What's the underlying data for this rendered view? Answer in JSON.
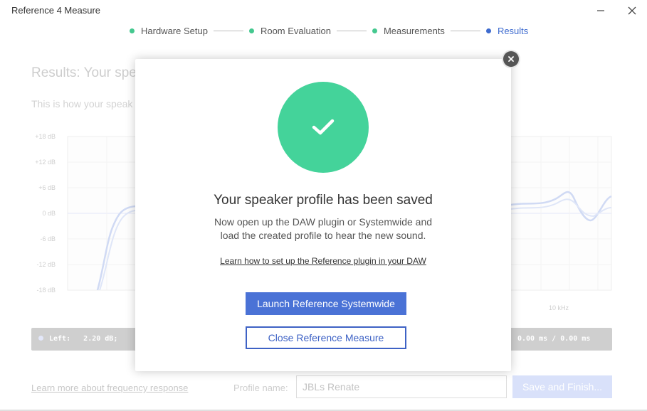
{
  "window": {
    "title": "Reference 4 Measure"
  },
  "stepper": {
    "steps": [
      {
        "label": "Hardware Setup"
      },
      {
        "label": "Room Evaluation"
      },
      {
        "label": "Measurements"
      },
      {
        "label": "Results"
      }
    ]
  },
  "background": {
    "title": "Results: Your spe",
    "subtitle": "This is how your speak",
    "chart": {
      "y_ticks": [
        "+18 dB",
        "+12 dB",
        "+6 dB",
        "0 dB",
        "-6 dB",
        "-12 dB",
        "-18 dB"
      ],
      "x_tick": "10 kHz"
    },
    "stats": {
      "left_label": "Left:",
      "left_value": "2.20 dB;",
      "right_value": "0.00 ms / 0.00 ms"
    },
    "learn_link": "Learn more about frequency response",
    "profile_label": "Profile name:",
    "profile_value": "JBLs Renate",
    "save_label": "Save and Finish..."
  },
  "modal": {
    "heading": "Your speaker profile has been saved",
    "text_line1": "Now open up the DAW plugin or Systemwide and",
    "text_line2": "load the created profile to hear the new sound.",
    "link": "Learn how to set up the Reference plugin in your DAW",
    "primary_button": "Launch Reference Systemwide",
    "secondary_button": "Close Reference Measure"
  },
  "colors": {
    "accent": "#4a72d6",
    "success": "#44d39a",
    "step_done": "#44c88f"
  }
}
